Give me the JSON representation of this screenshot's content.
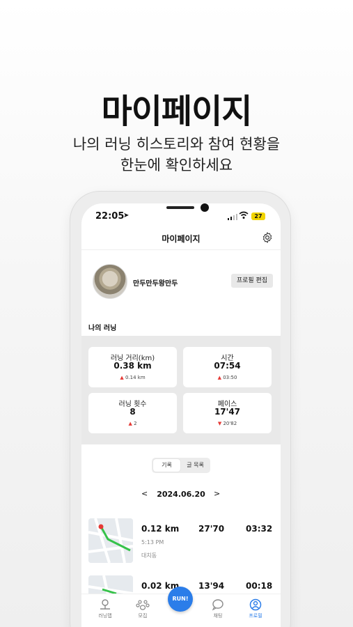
{
  "hero": {
    "title": "마이페이지",
    "subtitle_line1": "나의 러닝 히스토리와 참여 현황을",
    "subtitle_line2": "한눈에 확인하세요"
  },
  "status_bar": {
    "time": "22:05",
    "battery": "27"
  },
  "header": {
    "title": "마이페이지"
  },
  "profile": {
    "nickname": "만두만두왕만두",
    "edit_label": "프로필 편집"
  },
  "running": {
    "section_title": "나의 러닝",
    "stats": [
      {
        "label": "러닝 거리(km)",
        "value": "0.38 km",
        "delta": "0.14 km"
      },
      {
        "label": "시간",
        "value": "07:54",
        "delta": "03:50"
      },
      {
        "label": "러닝 횟수",
        "value": "8",
        "delta": "2"
      },
      {
        "label": "페이스",
        "value": "17'47",
        "delta": "20'82"
      }
    ]
  },
  "tabs": {
    "record": "기록",
    "posts": "글 목록"
  },
  "date_nav": {
    "prev": "<",
    "date": "2024.06.20",
    "next": ">"
  },
  "records": [
    {
      "distance": "0.12 km",
      "pace": "27'70",
      "duration": "03:32",
      "time": "5:13 PM",
      "location": "대치동"
    },
    {
      "distance": "0.02 km",
      "pace": "13'94",
      "duration": "00:18"
    }
  ],
  "tabbar": {
    "items": [
      {
        "label": "러닝맵",
        "icon": "map-pin-icon"
      },
      {
        "label": "모집",
        "icon": "paw-icon"
      },
      {
        "label": "채팅",
        "icon": "chat-icon"
      },
      {
        "label": "프로필",
        "icon": "profile-icon"
      }
    ],
    "run_label": "RUN!"
  },
  "colors": {
    "accent": "#2b7de9",
    "battery": "#f1d400",
    "delta": "#e53935"
  }
}
